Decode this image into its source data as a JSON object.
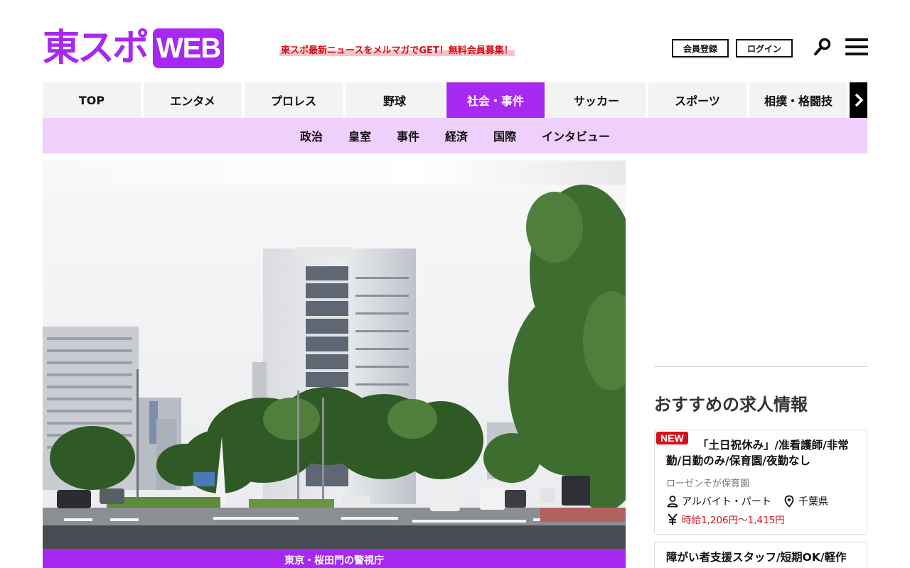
{
  "brand": {
    "logo_text": "東スポ",
    "logo_badge": "WEB",
    "accent_color": "#a728f0"
  },
  "header": {
    "promo_text": "東スポ最新ニュースをメルマガでGET！無料会員募集！",
    "register_label": "会員登録",
    "login_label": "ログイン",
    "search_icon": "search-icon",
    "menu_icon": "hamburger-menu-icon"
  },
  "nav": {
    "items": [
      {
        "label": "TOP"
      },
      {
        "label": "エンタメ"
      },
      {
        "label": "プロレス"
      },
      {
        "label": "野球"
      },
      {
        "label": "社会・事件"
      },
      {
        "label": "サッカー"
      },
      {
        "label": "スポーツ"
      },
      {
        "label": "相撲・格闘技"
      }
    ],
    "active_index": 4,
    "next_icon": "chevron-right-icon"
  },
  "subnav": {
    "items": [
      {
        "label": "政治"
      },
      {
        "label": "皇室"
      },
      {
        "label": "事件"
      },
      {
        "label": "経済"
      },
      {
        "label": "国際"
      },
      {
        "label": "インタビュー"
      }
    ]
  },
  "hero": {
    "caption": "東京・桜田門の警視庁"
  },
  "sidebar": {
    "section_title": "おすすめの求人情報",
    "jobs": [
      {
        "badge": "NEW",
        "title": "「土日祝休み」/准看護師/非常勤/日勤のみ/保育園/夜勤なし",
        "company": "ローゼンそが保育園",
        "employment_type": "アルバイト・パート",
        "location": "千葉県",
        "pay": "時給1,206円～1,415円"
      },
      {
        "title": "障がい者支援スタッフ/短期OK/軽作"
      }
    ]
  }
}
